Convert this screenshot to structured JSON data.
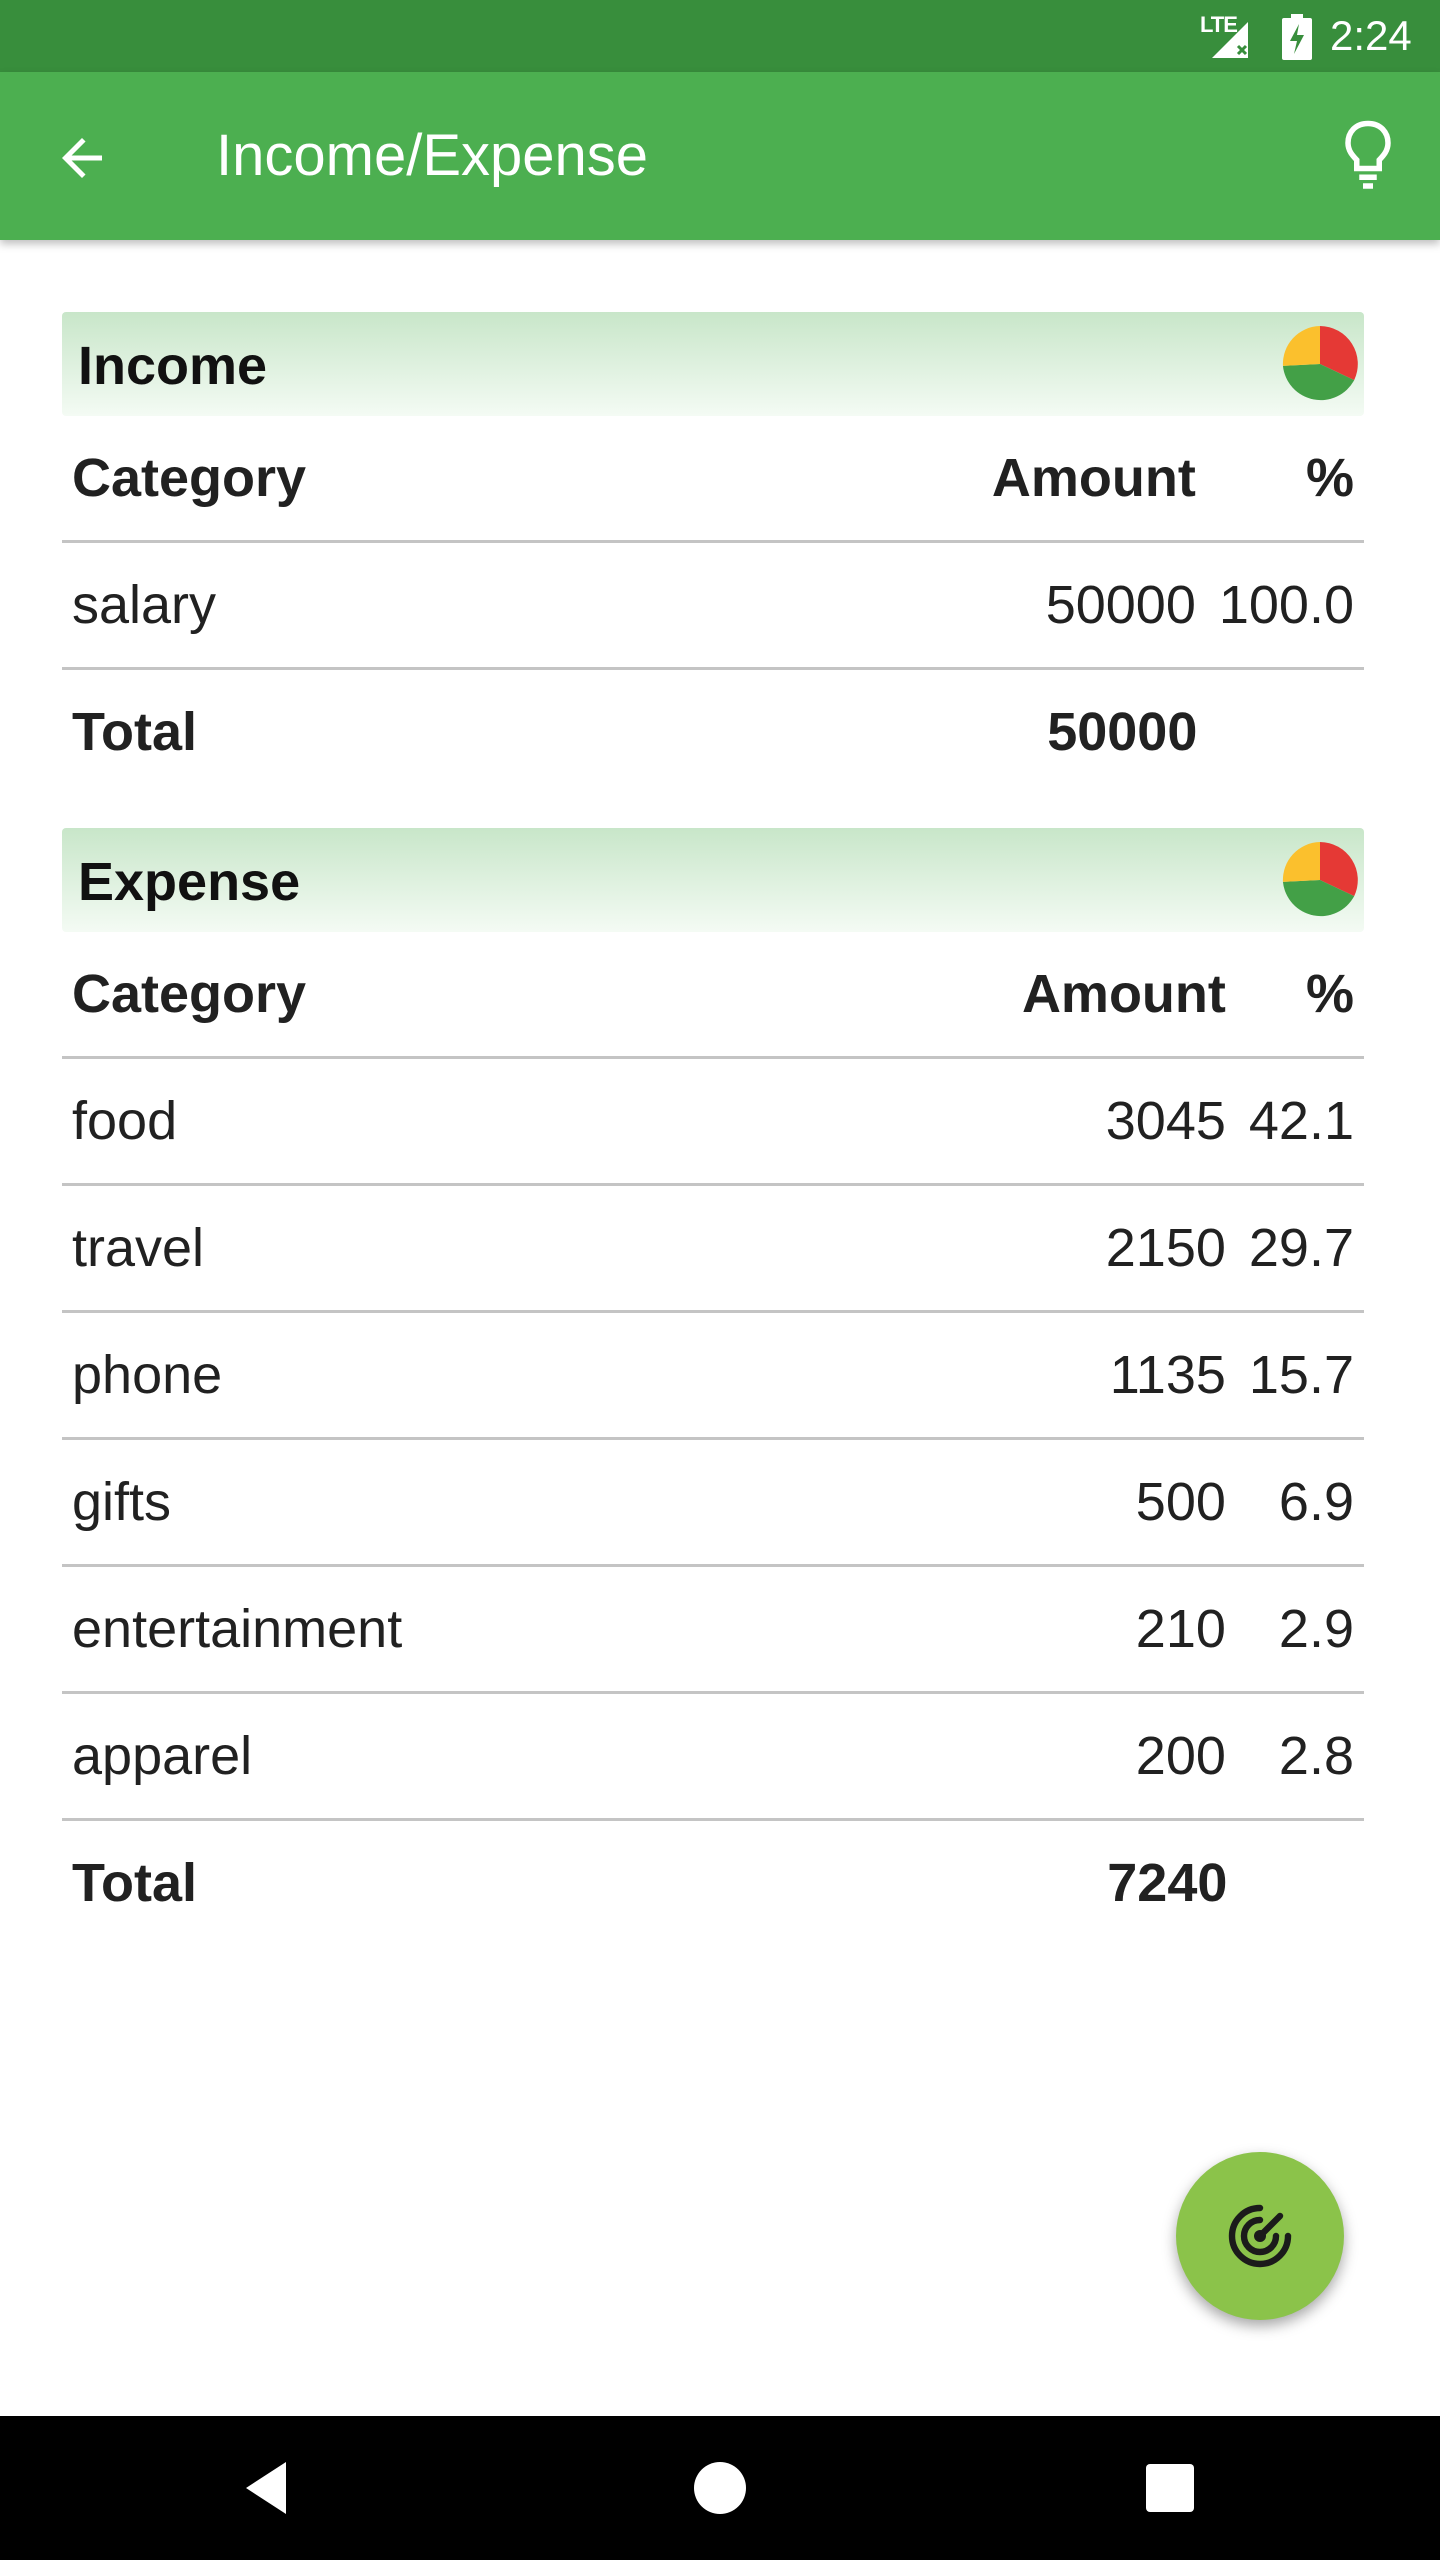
{
  "status_bar": {
    "network": "LTE",
    "time": "2:24"
  },
  "app_bar": {
    "title": "Income/Expense",
    "back_icon": "arrow-back-icon",
    "action_icon": "lightbulb-icon"
  },
  "income": {
    "title": "Income",
    "columns": [
      "Category",
      "Amount",
      "%"
    ],
    "rows": [
      {
        "category": "salary",
        "amount": "50000",
        "percent": "100.0"
      }
    ],
    "total_label": "Total",
    "total_amount": "50000"
  },
  "expense": {
    "title": "Expense",
    "columns": [
      "Category",
      "Amount",
      "%"
    ],
    "rows": [
      {
        "category": "food",
        "amount": "3045",
        "percent": "42.1"
      },
      {
        "category": "travel",
        "amount": "2150",
        "percent": "29.7"
      },
      {
        "category": "phone",
        "amount": "1135",
        "percent": "15.7"
      },
      {
        "category": "gifts",
        "amount": "500",
        "percent": "6.9"
      },
      {
        "category": "entertainment",
        "amount": "210",
        "percent": "2.9"
      },
      {
        "category": "apparel",
        "amount": "200",
        "percent": "2.8"
      }
    ],
    "total_label": "Total",
    "total_amount": "7240"
  },
  "fab": {
    "icon": "radar-icon"
  },
  "colors": {
    "status_bar": "#388e3c",
    "app_bar": "#4caf50",
    "fab": "#8bc34a",
    "pie_red": "#e53935",
    "pie_green": "#43a047",
    "pie_yellow": "#fbc02d"
  }
}
